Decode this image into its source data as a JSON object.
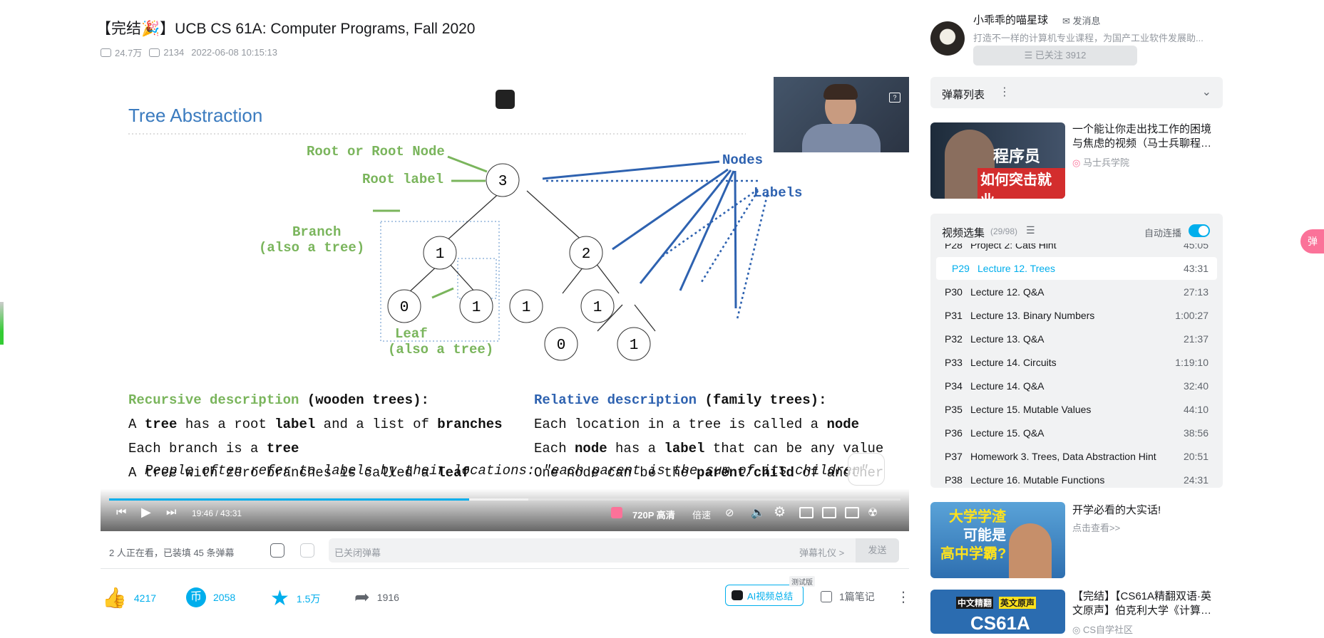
{
  "video": {
    "title": "【完结🎉】UCB CS 61A: Computer Programs, Fall 2020",
    "views": "24.7万",
    "danmaku_count": "2134",
    "date": "2022-06-08 10:15:13"
  },
  "slide": {
    "heading": "Tree Abstraction",
    "labels": {
      "root": "Root or Root Node",
      "root_label": "Root label",
      "nodes": "Nodes",
      "labels": "Labels",
      "branch1": "Branch",
      "branch2": "(also a tree)",
      "leaf1": "Leaf",
      "leaf2": "(also a tree)"
    },
    "node_values": {
      "root": "3",
      "a": "1",
      "b": "2",
      "a0": "0",
      "a1": "1",
      "b0": "1",
      "b1": "1",
      "b10": "0",
      "b11": "1"
    },
    "left": {
      "head_colored": "Recursive description",
      "head_rest": " (wooden trees):",
      "lines": [
        [
          {
            "t": "A ",
            "b": false
          },
          {
            "t": "tree",
            "b": true
          },
          {
            "t": " has a root ",
            "b": false
          },
          {
            "t": "label",
            "b": true
          },
          {
            "t": " and a list of ",
            "b": false
          },
          {
            "t": "branches",
            "b": true
          }
        ],
        [
          {
            "t": "Each branch is a ",
            "b": false
          },
          {
            "t": "tree",
            "b": true
          }
        ],
        [
          {
            "t": "A tree with zero branches is called a ",
            "b": false
          },
          {
            "t": "leaf",
            "b": true
          }
        ]
      ]
    },
    "right": {
      "head_colored": "Relative description",
      "head_rest": " (family trees):",
      "lines": [
        [
          {
            "t": "Each location in a tree is called a ",
            "b": false
          },
          {
            "t": "node",
            "b": true
          }
        ],
        [
          {
            "t": "Each ",
            "b": false
          },
          {
            "t": "node",
            "b": true
          },
          {
            "t": " has a ",
            "b": false
          },
          {
            "t": "label",
            "b": true
          },
          {
            "t": " that can be any value",
            "b": false
          }
        ],
        [
          {
            "t": "One node can be the ",
            "b": false
          },
          {
            "t": "parent",
            "b": true
          },
          {
            "t": "/",
            "b": false
          },
          {
            "t": "child",
            "b": true
          },
          {
            "t": " of another",
            "b": false
          }
        ]
      ]
    },
    "footer": "People often refer to labels by their locations: \"each parent is the sum of its children\""
  },
  "player": {
    "time": "19:46 / 43:31",
    "progress": 0.455,
    "buffered": 0.53,
    "quality": "720P 高清",
    "speed": "倍速",
    "colors": {
      "accent": "#00aeec",
      "pink": "#fb7299"
    }
  },
  "danmaku_bar": {
    "status": "2 人正在看，已装填 45 条弹幕",
    "placeholder": "已关闭弹幕",
    "etiquette": "弹幕礼仪 >",
    "send": "发送"
  },
  "toolbar": {
    "likes": "4217",
    "coins": "2058",
    "favorites": "1.5万",
    "shares": "1916",
    "ai_summary": "AI视频总结",
    "ai_badge": "测试版",
    "notes": "1篇笔记"
  },
  "uploader": {
    "name": "小乖乖的喵星球",
    "message": "发消息",
    "desc": "打造不一样的计算机专业课程，为国产工业软件发展助...",
    "follow": "已关注 3912"
  },
  "danmaku_list": {
    "label": "弹幕列表"
  },
  "recommend": [
    {
      "title1": "一个能让你走出找工作的困境",
      "title2": "与焦虑的视频（马士兵聊程…",
      "author": "马士兵学院",
      "thumb1": "程序员",
      "thumb2": "如何突击就业"
    },
    {
      "title1": "开学必看的大实话!",
      "title2": "",
      "author": "点击查看>>",
      "thumb1": "大学学渣",
      "thumb2": "可能是",
      "thumb3": "高中学霸?"
    },
    {
      "title1": "【完结】【CS61A精翻双语·英",
      "title2": "文原声】伯克利大学《计算…",
      "author": "CS自学社区",
      "thumb1": "中文精翻",
      "thumb2": "英文原声",
      "thumb3": "CS61A"
    }
  ],
  "episodes": {
    "header": "视频选集",
    "count": "(29/98)",
    "autoplay": "自动连播",
    "items": [
      {
        "n": "P28",
        "t": "Project 2: Cats Hint",
        "d": "45:05"
      },
      {
        "n": "P29",
        "t": "Lecture 12. Trees",
        "d": "43:31",
        "active": true
      },
      {
        "n": "P30",
        "t": "Lecture 12. Q&A",
        "d": "27:13"
      },
      {
        "n": "P31",
        "t": "Lecture 13. Binary Numbers",
        "d": "1:00:27"
      },
      {
        "n": "P32",
        "t": "Lecture 13. Q&A",
        "d": "21:37"
      },
      {
        "n": "P33",
        "t": "Lecture 14. Circuits",
        "d": "1:19:10"
      },
      {
        "n": "P34",
        "t": "Lecture 14. Q&A",
        "d": "32:40"
      },
      {
        "n": "P35",
        "t": "Lecture 15. Mutable Values",
        "d": "44:10"
      },
      {
        "n": "P36",
        "t": "Lecture 15. Q&A",
        "d": "38:56"
      },
      {
        "n": "P37",
        "t": "Homework 3. Trees, Data Abstraction Hint",
        "d": "20:51"
      },
      {
        "n": "P38",
        "t": "Lecture 16. Mutable Functions",
        "d": "24:31"
      }
    ]
  },
  "float_badge": "弹"
}
